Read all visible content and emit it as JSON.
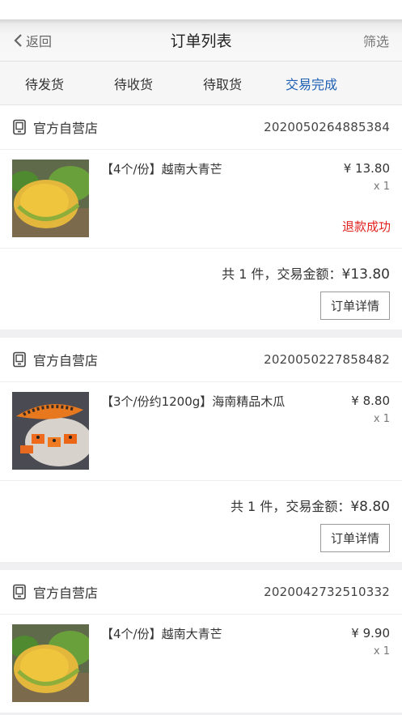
{
  "nav": {
    "back_label": "返回",
    "title": "订单列表",
    "filter_label": "筛选"
  },
  "tabs": [
    {
      "label": "待发货",
      "active": false
    },
    {
      "label": "待收货",
      "active": false
    },
    {
      "label": "待取货",
      "active": false
    },
    {
      "label": "交易完成",
      "active": true
    }
  ],
  "colors": {
    "accent": "#1e5fb4",
    "refund": "#e3211d"
  },
  "orders": [
    {
      "shop": "官方自营店",
      "order_no": "2020050264885384",
      "item": {
        "name": "【4个/份】越南大青芒",
        "price": "¥ 13.80",
        "qty": "x 1",
        "status": "退款成功",
        "image": "mango"
      },
      "total_prefix": "共 1 件，交易金额：",
      "total_amount": "¥13.80",
      "detail_label": "订单详情"
    },
    {
      "shop": "官方自营店",
      "order_no": "2020050227858482",
      "item": {
        "name": "【3个/份约1200g】海南精品木瓜",
        "price": "¥ 8.80",
        "qty": "x 1",
        "status": "",
        "image": "papaya"
      },
      "total_prefix": "共 1 件，交易金额：",
      "total_amount": "¥8.80",
      "detail_label": "订单详情"
    },
    {
      "shop": "官方自营店",
      "order_no": "2020042732510332",
      "item": {
        "name": "【4个/份】越南大青芒",
        "price": "¥ 9.90",
        "qty": "x 1",
        "status": "",
        "image": "mango"
      }
    }
  ]
}
